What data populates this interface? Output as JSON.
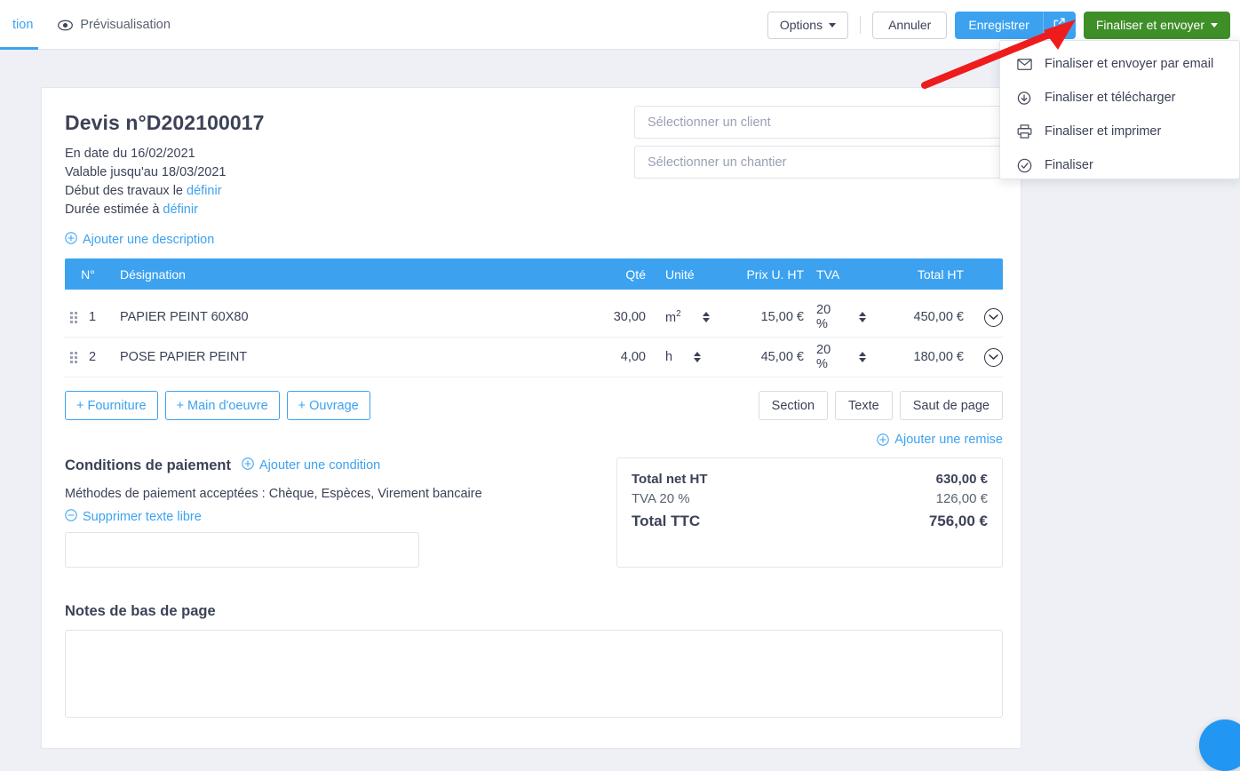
{
  "topbar": {
    "tabs": [
      {
        "label": "tion",
        "active": true,
        "truncated": true
      },
      {
        "label": "Prévisualisation",
        "icon": "eye-icon",
        "active": false
      }
    ],
    "options_label": "Options",
    "cancel_label": "Annuler",
    "save_label": "Enregistrer",
    "save_ext_icon": "external-link-icon",
    "finalize_label": "Finaliser et envoyer"
  },
  "dropdown": {
    "items": [
      {
        "label": "Finaliser et envoyer par email",
        "icon": "envelope-icon"
      },
      {
        "label": "Finaliser et télécharger",
        "icon": "cloud-download-icon"
      },
      {
        "label": "Finaliser et imprimer",
        "icon": "printer-icon"
      },
      {
        "label": "Finaliser",
        "icon": "check-circle-icon"
      }
    ]
  },
  "document": {
    "title": "Devis n°D202100017",
    "date_line": "En date du 16/02/2021",
    "valid_line": "Valable jusqu'au 18/03/2021",
    "works_start_prefix": "Début des travaux le ",
    "works_start_link": "définir",
    "duration_prefix": "Durée estimée à ",
    "duration_link": "définir",
    "add_description": "Ajouter une description",
    "client_placeholder": "Sélectionner un client",
    "site_placeholder": "Sélectionner un chantier"
  },
  "table": {
    "headers": {
      "num": "N°",
      "designation": "Désignation",
      "qty": "Qté",
      "unit": "Unité",
      "unit_price": "Prix U. HT",
      "vat": "TVA",
      "total": "Total HT"
    },
    "rows": [
      {
        "num": "1",
        "designation": "PAPIER PEINT 60X80",
        "qty": "30,00",
        "unit": "m²",
        "unit_price": "15,00 €",
        "vat": "20 %",
        "total": "450,00 €"
      },
      {
        "num": "2",
        "designation": "POSE PAPIER PEINT",
        "qty": "4,00",
        "unit": "h",
        "unit_price": "45,00 €",
        "vat": "20 %",
        "total": "180,00 €"
      }
    ]
  },
  "actions": {
    "add_supply": "Fourniture",
    "add_labour": "Main d'oeuvre",
    "add_work": "Ouvrage",
    "section": "Section",
    "text": "Texte",
    "page_break": "Saut de page",
    "add_discount": "Ajouter une remise"
  },
  "conditions": {
    "title": "Conditions de paiement",
    "add_condition": "Ajouter une condition",
    "methods_text": "Méthodes de paiement acceptées : Chèque, Espèces, Virement bancaire",
    "remove_free_text": "Supprimer texte libre",
    "free_text_value": ""
  },
  "totals": {
    "net_ht_label": "Total net HT",
    "net_ht_value": "630,00 €",
    "vat_label": "TVA 20 %",
    "vat_value": "126,00 €",
    "ttc_label": "Total TTC",
    "ttc_value": "756,00 €"
  },
  "notes": {
    "title": "Notes de bas de page",
    "value": ""
  },
  "colors": {
    "accent_blue": "#3ca2f0",
    "green": "#3f8f29",
    "page_bg": "#eef0f5",
    "text": "#3c4257",
    "annotation_red": "#ee1c1c"
  }
}
